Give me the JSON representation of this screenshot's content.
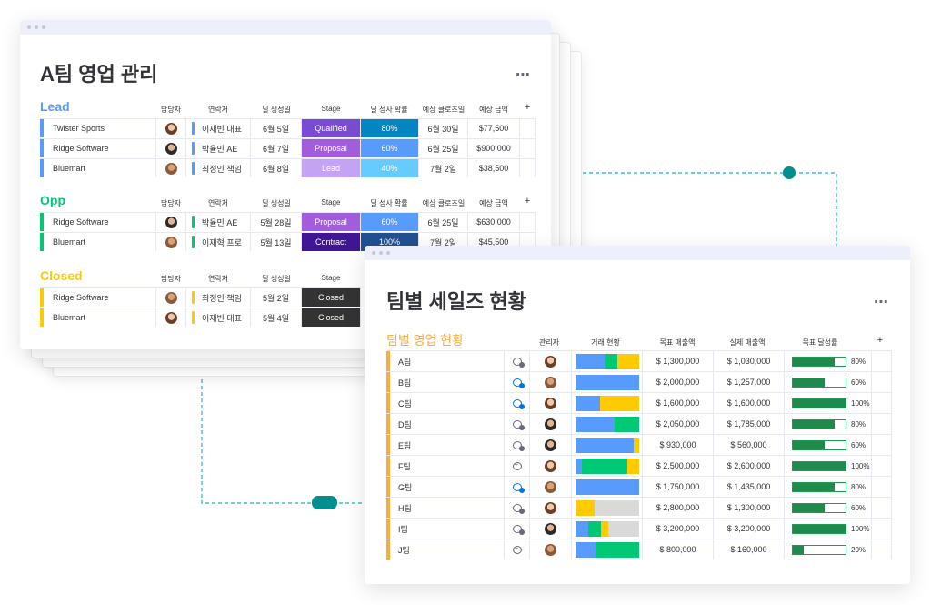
{
  "colors": {
    "lead": "#579bfc",
    "opp": "#00c875",
    "closed": "#ffcb00",
    "qualified": "#784bd1",
    "proposal": "#a25ddc",
    "lead_status": "#c4a3f5",
    "contract": "#401694",
    "closed_status": "#333333",
    "prob_80": "#0086c0",
    "prob_60": "#579bfc",
    "prob_40": "#66ccff",
    "prob_100": "#225091",
    "teams_orange": "#fdab3d",
    "accent_teal": "#008e8e",
    "deal_blue": "#579bfc",
    "deal_green": "#00c875",
    "deal_yellow": "#ffcb00",
    "deal_gray": "#d9d9d9"
  },
  "left_board": {
    "title": "A팀 영업 관리",
    "more_icon": "⋯",
    "columns": [
      "담당자",
      "연락처",
      "딜 생성일",
      "Stage",
      "딜 성사 확률",
      "예상 클로즈일",
      "예상 금액",
      "+"
    ],
    "columns_closed": [
      "담당자",
      "연락처",
      "딜 생성일",
      "Stage"
    ],
    "groups": [
      {
        "title": "Lead",
        "rows": [
          {
            "name": "Twister Sports",
            "contact": "이재빈 대표",
            "created": "6월 5일",
            "stage": "Qualified",
            "prob": "80%",
            "close": "6월 30일",
            "amount": "$77,500"
          },
          {
            "name": "Ridge Software",
            "contact": "박율민 AE",
            "created": "6월 7일",
            "stage": "Proposal",
            "prob": "60%",
            "close": "6월 25일",
            "amount": "$900,000"
          },
          {
            "name": "Bluemart",
            "contact": "최정인 책임",
            "created": "6월 8일",
            "stage": "Lead",
            "prob": "40%",
            "close": "7월 2일",
            "amount": "$38,500"
          }
        ]
      },
      {
        "title": "Opp",
        "rows": [
          {
            "name": "Ridge Software",
            "contact": "박율민 AE",
            "created": "5월 28일",
            "stage": "Proposal",
            "prob": "60%",
            "close": "6월 25일",
            "amount": "$630,000"
          },
          {
            "name": "Bluemart",
            "contact": "이재혁 프로",
            "created": "5월 13일",
            "stage": "Contract",
            "prob": "100%",
            "close": "7월 2일",
            "amount": "$45,500"
          }
        ]
      },
      {
        "title": "Closed",
        "rows": [
          {
            "name": "Ridge Software",
            "contact": "최정인 책임",
            "created": "5월 2일",
            "stage": "Closed"
          },
          {
            "name": "Bluemart",
            "contact": "이재빈 대표",
            "created": "5월 4일",
            "stage": "Closed"
          }
        ]
      }
    ]
  },
  "right_board": {
    "title": "팀별 세일즈 현황",
    "more_icon": "⋯",
    "group_title": "팀별 영업 현황",
    "columns": [
      "관리자",
      "거래 현황",
      "목표 매출액",
      "실제 매출액",
      "목표 달성률",
      "+"
    ],
    "rows": [
      {
        "team": "A팀",
        "target": "$ 1,300,000",
        "actual": "$ 1,030,000",
        "rate": "80%",
        "rate_value": 0.8,
        "deal": [
          0.45,
          0.2,
          0.35,
          0
        ],
        "chat": "gray"
      },
      {
        "team": "B팀",
        "target": "$ 2,000,000",
        "actual": "$ 1,257,000",
        "rate": "60%",
        "rate_value": 0.6,
        "deal": [
          1,
          0,
          0,
          0
        ],
        "chat": "blue"
      },
      {
        "team": "C팀",
        "target": "$ 1,600,000",
        "actual": "$ 1,600,000",
        "rate": "100%",
        "rate_value": 1.0,
        "deal": [
          0.38,
          0,
          0.62,
          0
        ],
        "chat": "blue"
      },
      {
        "team": "D팀",
        "target": "$ 2,050,000",
        "actual": "$ 1,785,000",
        "rate": "80%",
        "rate_value": 0.8,
        "deal": [
          0.62,
          0.38,
          0,
          0
        ],
        "chat": "gray"
      },
      {
        "team": "E팀",
        "target": "$ 930,000",
        "actual": "$ 560,000",
        "rate": "60%",
        "rate_value": 0.6,
        "deal": [
          0.92,
          0,
          0.08,
          0
        ],
        "chat": "gray"
      },
      {
        "team": "F팀",
        "target": "$ 2,500,000",
        "actual": "$ 2,600,000",
        "rate": "100%",
        "rate_value": 1.0,
        "deal": [
          0.1,
          0.72,
          0.18,
          0
        ],
        "chat": "plus"
      },
      {
        "team": "G팀",
        "target": "$ 1,750,000",
        "actual": "$ 1,435,000",
        "rate": "80%",
        "rate_value": 0.8,
        "deal": [
          1,
          0,
          0,
          0
        ],
        "chat": "blue"
      },
      {
        "team": "H팀",
        "target": "$ 2,800,000",
        "actual": "$ 1,300,000",
        "rate": "60%",
        "rate_value": 0.6,
        "deal": [
          0,
          0,
          0.3,
          0.7
        ],
        "chat": "gray"
      },
      {
        "team": "I팀",
        "target": "$ 3,200,000",
        "actual": "$ 3,200,000",
        "rate": "100%",
        "rate_value": 1.0,
        "deal": [
          0.2,
          0.2,
          0.12,
          0.48
        ],
        "chat": "gray"
      },
      {
        "team": "J팀",
        "target": "$ 800,000",
        "actual": "$ 160,000",
        "rate": "20%",
        "rate_value": 0.2,
        "deal": [
          0.32,
          0.68,
          0,
          0
        ],
        "chat": "plus"
      }
    ]
  }
}
